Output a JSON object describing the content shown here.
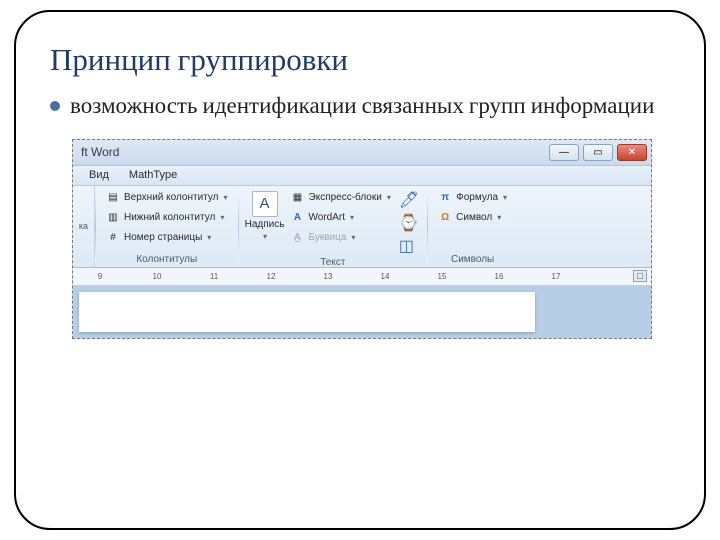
{
  "slide": {
    "title": "Принцип группировки",
    "bullet": "возможность идентификации связанных групп информации"
  },
  "window": {
    "title_suffix": "ft Word",
    "menu": {
      "view": "Вид",
      "mathtype": "MathType"
    },
    "left_edge": "ка"
  },
  "ribbon": {
    "kolontituly": {
      "label": "Колонтитулы",
      "header": "Верхний колонтитул",
      "footer": "Нижний колонтитул",
      "page_number": "Номер страницы"
    },
    "text": {
      "label": "Текст",
      "textbox": "Надпись",
      "quickparts": "Экспресс-блоки",
      "wordart": "WordArt",
      "dropcap": "Буквица"
    },
    "symbols": {
      "label": "Символы",
      "formula": "Формула",
      "symbol": "Символ"
    }
  },
  "ruler": [
    "9",
    "10",
    "11",
    "12",
    "13",
    "14",
    "15",
    "16",
    "17"
  ]
}
